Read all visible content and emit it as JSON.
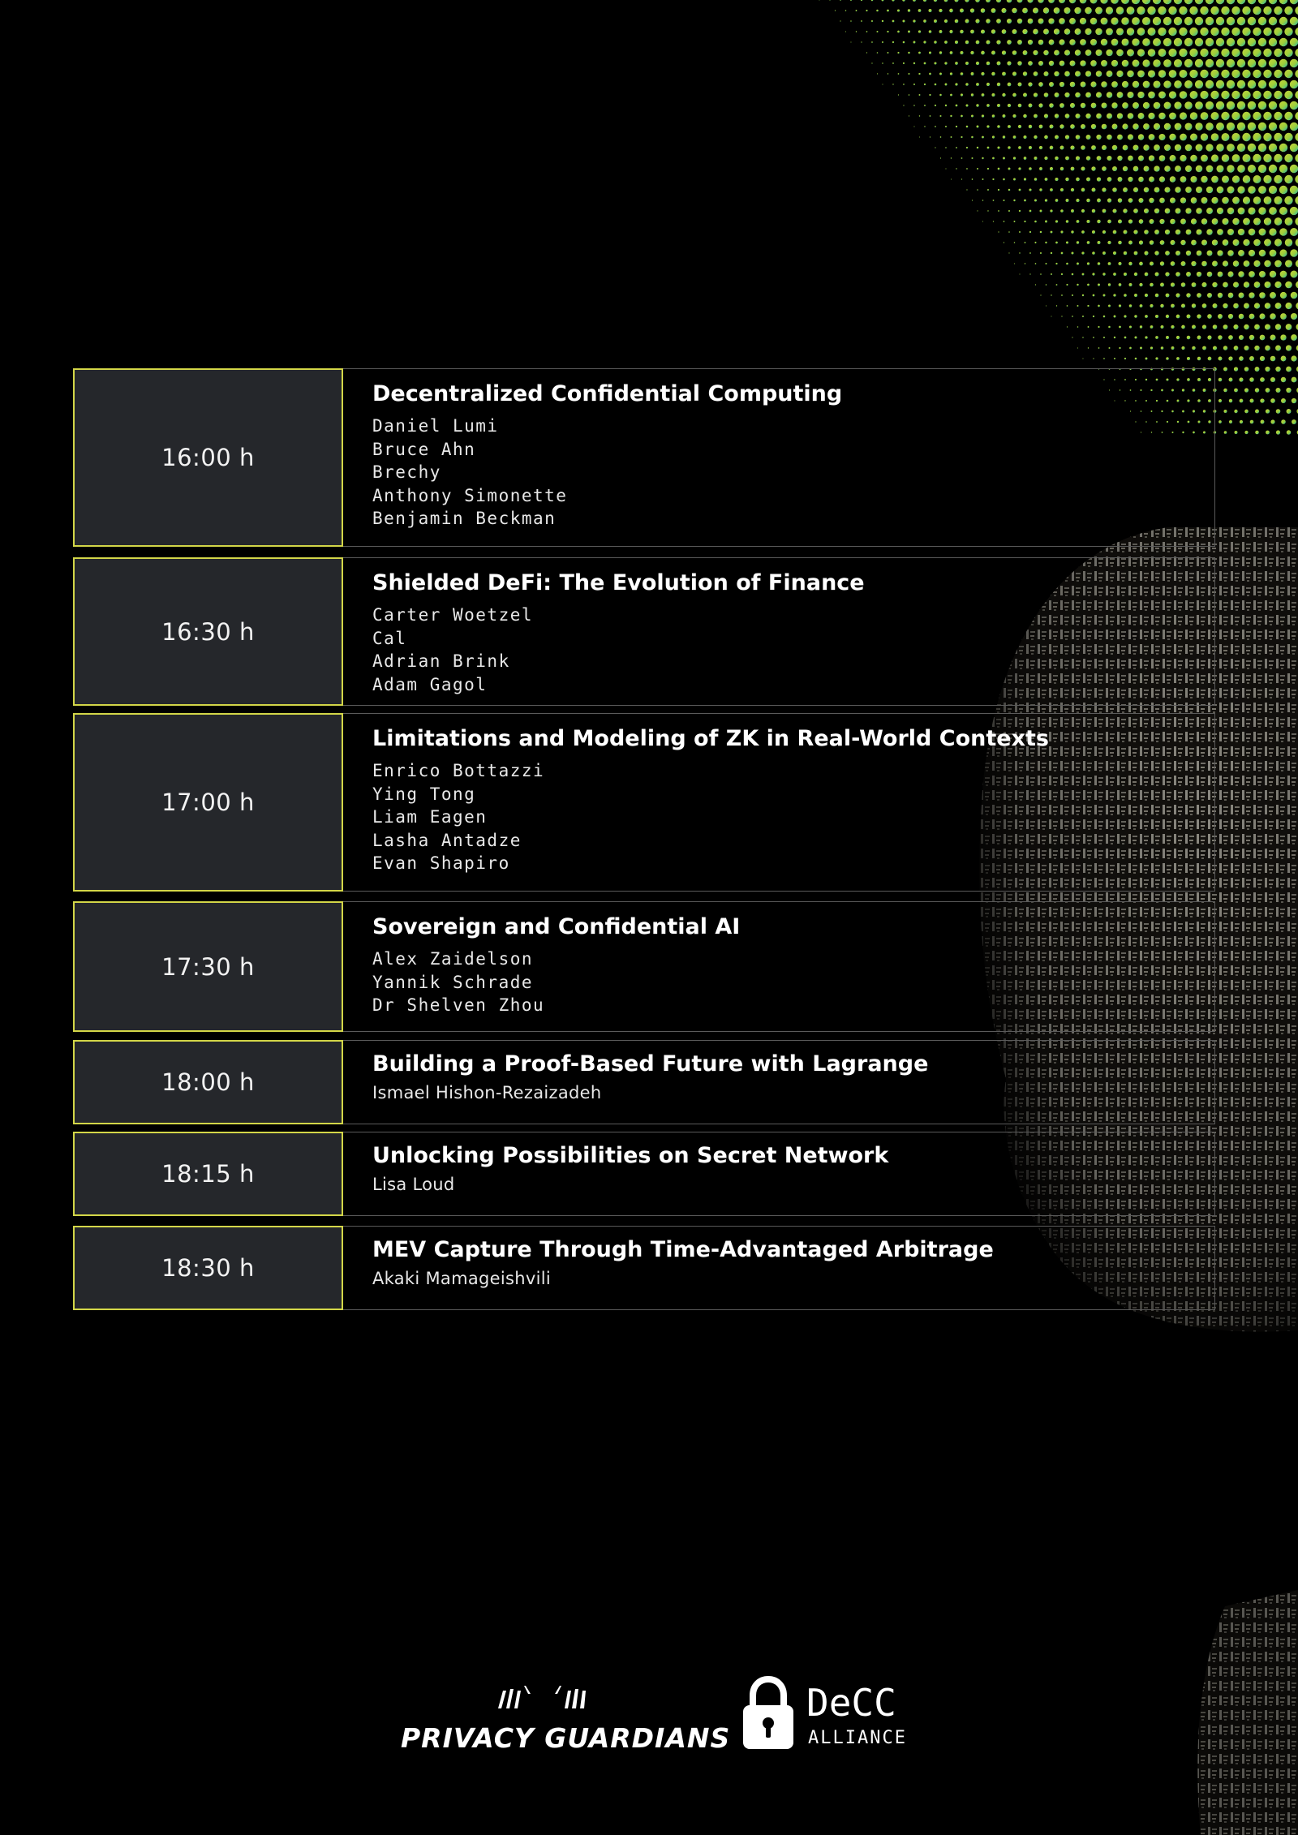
{
  "schedule": [
    {
      "time": "16:00 h",
      "title": "Decentralized Confidential Computing",
      "speakers": [
        "Daniel Lumi",
        "Bruce Ahn",
        "Brechy",
        "Anthony Simonette",
        "Benjamin Beckman"
      ]
    },
    {
      "time": "16:30 h",
      "title": "Shielded DeFi: The Evolution of Finance",
      "speakers": [
        "Carter Woetzel",
        "Cal",
        "Adrian Brink",
        "Adam Gagol"
      ]
    },
    {
      "time": "17:00 h",
      "title": "Limitations and Modeling of ZK in Real-World Contexts",
      "speakers": [
        "Enrico Bottazzi",
        "Ying Tong",
        "Liam Eagen",
        "Lasha Antadze",
        "Evan Shapiro"
      ]
    },
    {
      "time": "17:30 h",
      "title": "Sovereign and Confidential AI",
      "speakers": [
        "Alex Zaidelson",
        "Yannik Schrade",
        "Dr Shelven Zhou"
      ]
    },
    {
      "time": "18:00 h",
      "title": "Building a Proof-Based Future with Lagrange",
      "speakers": [
        "Ismael Hishon-Rezaizadeh"
      ]
    },
    {
      "time": "18:15 h",
      "title": "Unlocking Possibilities on Secret Network",
      "speakers": [
        "Lisa Loud"
      ]
    },
    {
      "time": "18:30 h",
      "title": "MEV Capture Through Time-Advantaged Arbitrage",
      "speakers": [
        "Akaki Mamageishvili"
      ]
    }
  ],
  "logos": {
    "privacy_guardians": "PRIVACY GUARDIANS",
    "decc_name": "DeCC",
    "decc_sub": "ALLIANCE"
  },
  "colors": {
    "accent": "#d3d648",
    "time_bg": "#25272b",
    "border": "#5a5a5a"
  }
}
